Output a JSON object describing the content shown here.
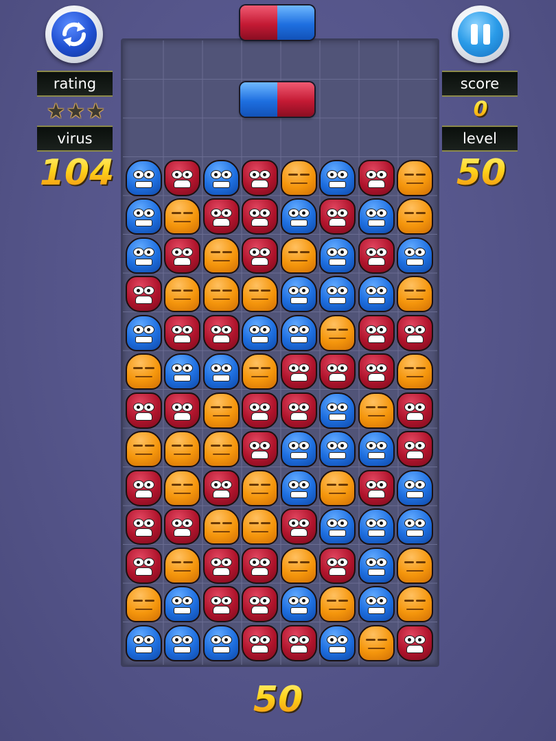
{
  "hud": {
    "rating_label": "rating",
    "virus_label": "virus",
    "score_label": "score",
    "level_label": "level",
    "virus_count": "104",
    "score": "0",
    "level": "50",
    "bottom_level": "50",
    "rating_stars": {
      "filled": 0,
      "total": 3,
      "glyph": "★"
    }
  },
  "buttons": {
    "restart": {
      "icon": "refresh-arrows-icon"
    },
    "pause": {
      "icon": "pause-icon"
    }
  },
  "colors": {
    "blue": "#1e6fe0",
    "red": "#b0142c",
    "orange": "#f5960c"
  },
  "capsules": {
    "next": [
      "red",
      "blue"
    ],
    "falling": [
      "blue",
      "red"
    ]
  },
  "board": {
    "columns": 8,
    "grid_rows": 16,
    "virus_rows": [
      [
        "B",
        "R",
        "B",
        "R",
        "O",
        "B",
        "R",
        "O"
      ],
      [
        "B",
        "O",
        "R",
        "R",
        "B",
        "R",
        "B",
        "O"
      ],
      [
        "B",
        "R",
        "O",
        "R",
        "O",
        "B",
        "R",
        "B"
      ],
      [
        "R",
        "O",
        "O",
        "O",
        "B",
        "B",
        "B",
        "O"
      ],
      [
        "B",
        "R",
        "R",
        "B",
        "B",
        "O",
        "R",
        "R"
      ],
      [
        "O",
        "B",
        "B",
        "O",
        "R",
        "R",
        "R",
        "O"
      ],
      [
        "R",
        "R",
        "O",
        "R",
        "R",
        "B",
        "O",
        "R"
      ],
      [
        "O",
        "O",
        "O",
        "R",
        "B",
        "B",
        "B",
        "R"
      ],
      [
        "R",
        "O",
        "R",
        "O",
        "B",
        "O",
        "R",
        "B"
      ],
      [
        "R",
        "R",
        "O",
        "O",
        "R",
        "B",
        "B",
        "B"
      ],
      [
        "R",
        "O",
        "R",
        "R",
        "O",
        "R",
        "B",
        "O"
      ],
      [
        "O",
        "B",
        "R",
        "R",
        "B",
        "O",
        "B",
        "O"
      ],
      [
        "B",
        "B",
        "B",
        "R",
        "R",
        "B",
        "O",
        "R"
      ]
    ]
  }
}
